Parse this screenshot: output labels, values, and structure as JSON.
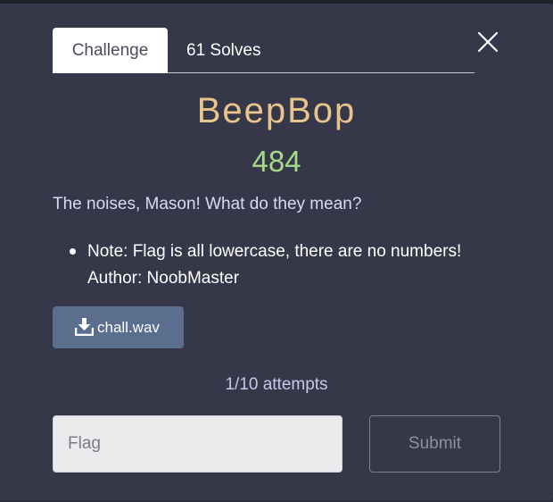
{
  "tabs": {
    "challenge_label": "Challenge",
    "solves_label": "61 Solves"
  },
  "challenge": {
    "name": "BeepBop",
    "points": "484",
    "description": "The noises, Mason! What do they mean?",
    "notes": [
      "Note: Flag is all lowercase, there are no numbers!",
      "Author: NoobMaster"
    ]
  },
  "file": {
    "label": "chall.wav",
    "icon": "download-icon"
  },
  "attempts": "1/10 attempts",
  "form": {
    "flag_placeholder": "Flag",
    "submit_label": "Submit"
  },
  "colors": {
    "modal_bg": "#363849",
    "title": "#e9c48c",
    "points": "#a6d98a",
    "download_btn": "#5b6e8d"
  }
}
